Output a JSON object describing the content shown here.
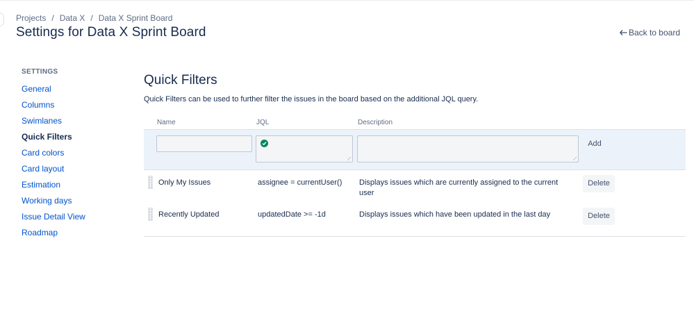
{
  "breadcrumb": {
    "items": [
      "Projects",
      "Data X",
      "Data X Sprint Board"
    ],
    "separator": "/"
  },
  "page_title": "Settings for Data X Sprint Board",
  "back_link": "Back to board",
  "sidebar": {
    "heading": "SETTINGS",
    "items": [
      {
        "label": "General",
        "active": false
      },
      {
        "label": "Columns",
        "active": false
      },
      {
        "label": "Swimlanes",
        "active": false
      },
      {
        "label": "Quick Filters",
        "active": true
      },
      {
        "label": "Card colors",
        "active": false
      },
      {
        "label": "Card layout",
        "active": false
      },
      {
        "label": "Estimation",
        "active": false
      },
      {
        "label": "Working days",
        "active": false
      },
      {
        "label": "Issue Detail View",
        "active": false
      },
      {
        "label": "Roadmap",
        "active": false
      }
    ]
  },
  "main": {
    "title": "Quick Filters",
    "description": "Quick Filters can be used to further filter the issues in the board based on the additional JQL query.",
    "columns": {
      "name": "Name",
      "jql": "JQL",
      "description": "Description"
    },
    "add_form": {
      "name_value": "",
      "jql_value": "",
      "description_value": "",
      "jql_status_icon": "check-circle-icon",
      "add_label": "Add"
    },
    "filters": [
      {
        "name": "Only My Issues",
        "jql": "assignee = currentUser()",
        "description": "Displays issues which are currently assigned to the current user",
        "delete_label": "Delete"
      },
      {
        "name": "Recently Updated",
        "jql": "updatedDate >= -1d",
        "description": "Displays issues which have been updated in the last day",
        "delete_label": "Delete"
      }
    ]
  },
  "colors": {
    "link": "#0052cc",
    "text": "#172b4d",
    "subtle": "#5e6c84",
    "add_row_bg": "#ebf2fa",
    "success": "#00875a"
  }
}
